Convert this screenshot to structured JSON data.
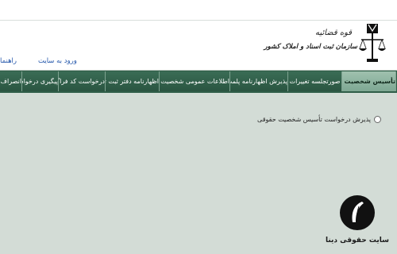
{
  "header": {
    "logo": {
      "top_text": "قوه قضائیه",
      "bottom_text": "سازمان ثبت اسناد و املاک کشور"
    },
    "links": {
      "login": "ورود به سایت",
      "help": "راهنما"
    }
  },
  "tabs": [
    {
      "label": "تأسیس شخصیت حقوقی",
      "active": true
    },
    {
      "label": "صورتجلسه تغییرات",
      "active": false
    },
    {
      "label": "پذیرش اظهارنامه پلمپ دفاتر قانونی",
      "active": false
    },
    {
      "label": "اطلاعات عمومی شخصیت حقوقی",
      "active": false
    },
    {
      "label": "اظهارنامه دفتر ثبت تجارتی",
      "active": false
    },
    {
      "label": "درخواست کد فراگیر",
      "active": false
    },
    {
      "label": "پیگیری درخواست",
      "active": false
    },
    {
      "label": "انصراف از",
      "active": false
    }
  ],
  "main": {
    "option_label": "پذیرش درخواست تأسیس شخصیت حقوقی",
    "option_checked": false
  },
  "watermark": {
    "text": "سایت حقوقی دینا"
  },
  "colors": {
    "tab_bg": "#2f5e48",
    "tab_active": "#8fb5a1",
    "page_bg": "#d3dcd6",
    "link": "#2255aa"
  }
}
